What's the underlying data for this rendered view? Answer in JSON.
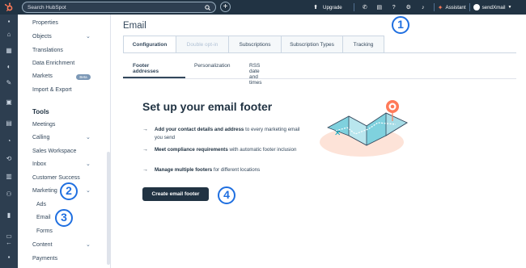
{
  "topbar": {
    "search_placeholder": "Search HubSpot",
    "upgrade_label": "Upgrade",
    "assistant_label": "Assistant",
    "account_label": "sendXmail"
  },
  "sidebar": {
    "items": [
      {
        "label": "Properties"
      },
      {
        "label": "Objects"
      },
      {
        "label": "Translations"
      },
      {
        "label": "Data Enrichment"
      },
      {
        "label": "Markets",
        "badge": "Beta"
      },
      {
        "label": "Import & Export"
      }
    ],
    "tools_heading": "Tools",
    "tools": [
      {
        "label": "Meetings"
      },
      {
        "label": "Calling"
      },
      {
        "label": "Sales Workspace"
      },
      {
        "label": "Inbox"
      },
      {
        "label": "Customer Success"
      },
      {
        "label": "Marketing"
      },
      {
        "label": "Ads"
      },
      {
        "label": "Email"
      },
      {
        "label": "Forms"
      },
      {
        "label": "Content"
      },
      {
        "label": "Payments"
      }
    ]
  },
  "main": {
    "title": "Email",
    "tabs": [
      {
        "label": "Configuration"
      },
      {
        "label": "Double opt-in"
      },
      {
        "label": "Subscriptions"
      },
      {
        "label": "Subscription Types"
      },
      {
        "label": "Tracking"
      }
    ],
    "subtabs": [
      {
        "label": "Footer addresses"
      },
      {
        "label": "Personalization"
      },
      {
        "label": "RSS date and times"
      }
    ],
    "hero_title": "Set up your email footer",
    "bullets": [
      {
        "bold": "Add your contact details and address",
        "rest": " to every marketing email you send"
      },
      {
        "bold": "Meet compliance requirements",
        "rest": " with automatic footer inclusion"
      },
      {
        "bold": "Manage multiple footers",
        "rest": " for different locations"
      }
    ],
    "cta_label": "Create email footer"
  },
  "annotations": [
    "1",
    "2",
    "3",
    "4"
  ],
  "colors": {
    "topbar": "#213343",
    "rail": "#2d3e50",
    "accent_orange": "#ff7a59",
    "annotation_blue": "#1f6fe0",
    "illustration_teal": "#00a4bd"
  }
}
